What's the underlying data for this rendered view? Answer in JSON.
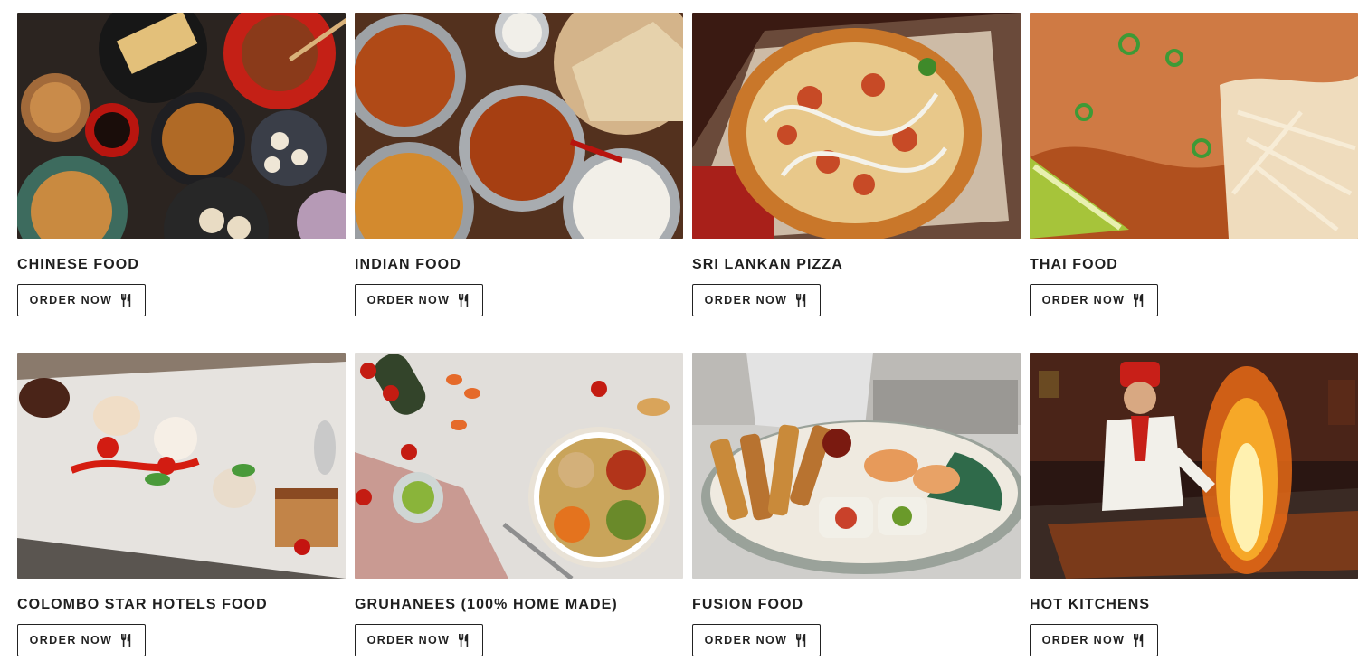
{
  "cards": [
    {
      "title": "CHINESE FOOD",
      "button": "ORDER NOW",
      "image": "chinese-food-photo",
      "palette": [
        "#2b2420",
        "#a8391c",
        "#d9a25a",
        "#3d5a4a"
      ]
    },
    {
      "title": "INDIAN FOOD",
      "button": "ORDER NOW",
      "image": "indian-food-photo",
      "palette": [
        "#3a2416",
        "#b04a17",
        "#d98a36",
        "#e8e1d2"
      ]
    },
    {
      "title": "SRI LANKAN PIZZA",
      "button": "ORDER NOW",
      "image": "pizza-photo",
      "palette": [
        "#4a1c12",
        "#d98c3a",
        "#f0d2a0",
        "#8a2a1c"
      ]
    },
    {
      "title": "THAI FOOD",
      "button": "ORDER NOW",
      "image": "thai-food-photo",
      "palette": [
        "#c96a3a",
        "#e7b07a",
        "#f4e3c8",
        "#5f8a2e"
      ]
    },
    {
      "title": "COLOMBO STAR HOTELS FOOD",
      "button": "ORDER NOW",
      "image": "hotel-dessert-photo",
      "palette": [
        "#e9e6e2",
        "#c7c2bb",
        "#c9301e",
        "#9b5a2c"
      ]
    },
    {
      "title": "GRUHANEES (100% HOME MADE)",
      "button": "ORDER NOW",
      "image": "home-made-bowl-photo",
      "palette": [
        "#e4e1de",
        "#cf8e6e",
        "#6f8f3a",
        "#e06a2a"
      ]
    },
    {
      "title": "FUSION FOOD",
      "button": "ORDER NOW",
      "image": "fusion-platter-photo",
      "palette": [
        "#d2d1cf",
        "#b87330",
        "#e6d9c4",
        "#2f6a4a"
      ]
    },
    {
      "title": "HOT KITCHENS",
      "button": "ORDER NOW",
      "image": "teppanyaki-chef-photo",
      "palette": [
        "#2a1a14",
        "#6b2a14",
        "#f2a12a",
        "#e9e2d8"
      ]
    }
  ]
}
